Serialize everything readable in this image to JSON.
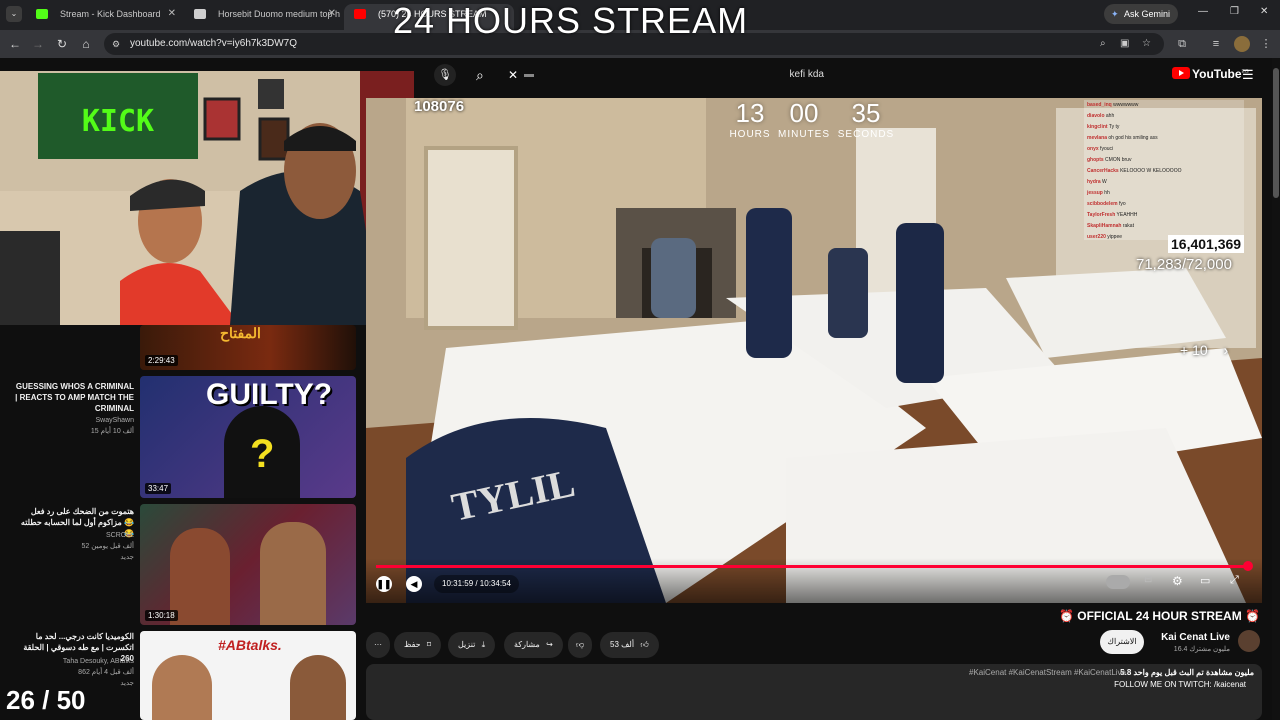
{
  "overlay": {
    "title": "24 HOURS STREAM",
    "counter": "26 / 50"
  },
  "browser": {
    "tabs": [
      {
        "label": "Stream - Kick Dashboard",
        "favicon_color": "#53fc18"
      },
      {
        "label": "Horsebit Duomo medium top h",
        "favicon_color": "#cfcfcf"
      },
      {
        "label": "(570) 24 HOURS STREAM",
        "favicon_color": "#ff0000"
      }
    ],
    "ask_gemini": "Ask Gemini",
    "url": "youtube.com/watch?v=iy6h7k3DW7Q"
  },
  "youtube": {
    "logo_text": "YouTube",
    "logo_region": "EG",
    "search_value": "kefi kda",
    "search_cursor": "▬"
  },
  "player": {
    "view_counter": "108076",
    "countdown": {
      "hours": "13",
      "minutes": "00",
      "seconds": "35",
      "hours_label": "HOURS",
      "minutes_label": "MINUTES",
      "seconds_label": "SECONDS"
    },
    "sub_count": "16,401,369",
    "sub_goal": "71,283/72,000",
    "skip_label": "+ 10",
    "time": "10:31:59 / 10:34:54",
    "progress": 0.9953,
    "jersey_text": "TYLIL",
    "chat": [
      {
        "user": "based_inq",
        "msg": "wwwwwww"
      },
      {
        "user": "diavolo",
        "msg": "ahh"
      },
      {
        "user": "kingclint",
        "msg": "Ty ty"
      },
      {
        "user": "mevlana",
        "msg": "oh god his smiling ass"
      },
      {
        "user": "onyx",
        "msg": "fyouci"
      },
      {
        "user": "ghopts",
        "msg": "CMON bruv"
      },
      {
        "user": "CancerHacks",
        "msg": "KELOOOO W KELOOOOO"
      },
      {
        "user": "hydra",
        "msg": "W"
      },
      {
        "user": "jessup",
        "msg": "hh"
      },
      {
        "user": "scibbodelem",
        "msg": "fyo"
      },
      {
        "user": "TaylorFresh",
        "msg": "YEAHHH"
      },
      {
        "user": "SkapliHamnah",
        "msg": "rakat"
      },
      {
        "user": "user220",
        "msg": "yippee"
      }
    ]
  },
  "video": {
    "title": "⏰ OFFICIAL 24 HOUR STREAM ⏰",
    "channel": "Kai Cenat Live",
    "subscribers": "16.4 مليون مشترك",
    "subscribe_label": "الاشتراك",
    "actions": {
      "like": "53 ألف",
      "share": "مشاركة",
      "download": "تنزيل",
      "save": "حفظ",
      "more": "···"
    },
    "views_line": "5.8 مليون مشاهدة  تم البث قبل يوم واحد",
    "hashtags": "#KaiCenat #KaiCenatStream #KaiCenatLive",
    "description": "FOLLOW ME ON TWITCH: /kaicenat"
  },
  "sidebar": [
    {
      "title": "",
      "channel": "",
      "meta": "",
      "duration": "2:29:43",
      "thumb_text": "المفتاح"
    },
    {
      "title": "GUESSING WHOS A CRIMINAL | REACTS TO AMP MATCH THE CRIMINAL",
      "channel": "SwayShawn",
      "meta": "15 ألف 10 أيام",
      "duration": "33:47",
      "thumb_text": "GUILTY?"
    },
    {
      "title": "هتموت من الضحك على رد فعل مزاكوم أول لما الحسابه حطلته 😂😂",
      "channel": "SCROLL",
      "meta": "52 ألف  قبل يومين",
      "badge": "جديد",
      "duration": "1:30:18",
      "thumb_text": ""
    },
    {
      "title": "الكوميديا كانت درجي... لحد ما اتكسرت | مع طه دسوقي | الحلقة 260",
      "channel": "Taha Desouky, ABtalks",
      "meta": "862 ألف  قبل 4 أيام",
      "badge": "جديد",
      "duration": "",
      "thumb_text": "#ABtalks."
    }
  ],
  "colors": {
    "accent": "#ff0033",
    "kick_green": "#53fc18",
    "bg": "#0f0f0f"
  }
}
